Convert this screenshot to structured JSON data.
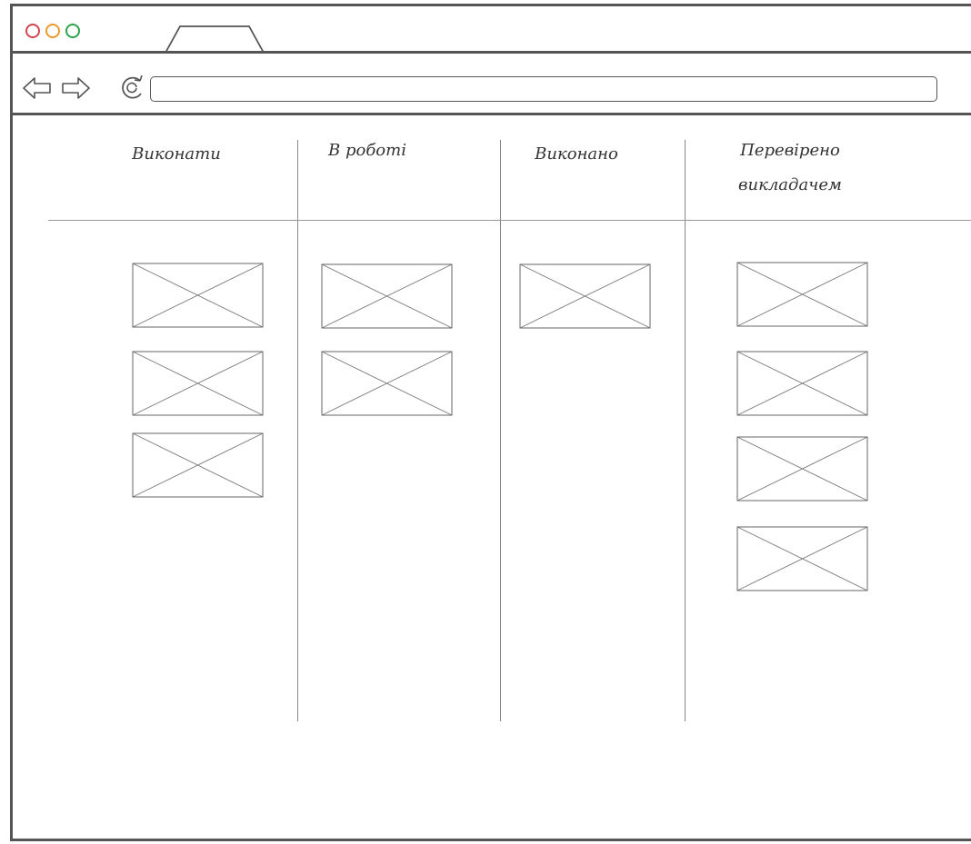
{
  "browser": {
    "window_controls": [
      "close",
      "minimize",
      "maximize"
    ],
    "tab_label": "",
    "nav": {
      "back_icon": "arrow-left-icon",
      "forward_icon": "arrow-right-icon",
      "refresh_icon": "reload-icon"
    },
    "address": {
      "value": "",
      "placeholder": ""
    }
  },
  "board": {
    "columns": [
      {
        "title_line1": "Виконати",
        "title_line2": "",
        "card_count": 3
      },
      {
        "title_line1": "В роботі",
        "title_line2": "",
        "card_count": 2
      },
      {
        "title_line1": "Виконано",
        "title_line2": "",
        "card_count": 1
      },
      {
        "title_line1": "Перевірено",
        "title_line2": "викладачем",
        "card_count": 4
      }
    ],
    "card_icon": "image-placeholder-icon"
  }
}
